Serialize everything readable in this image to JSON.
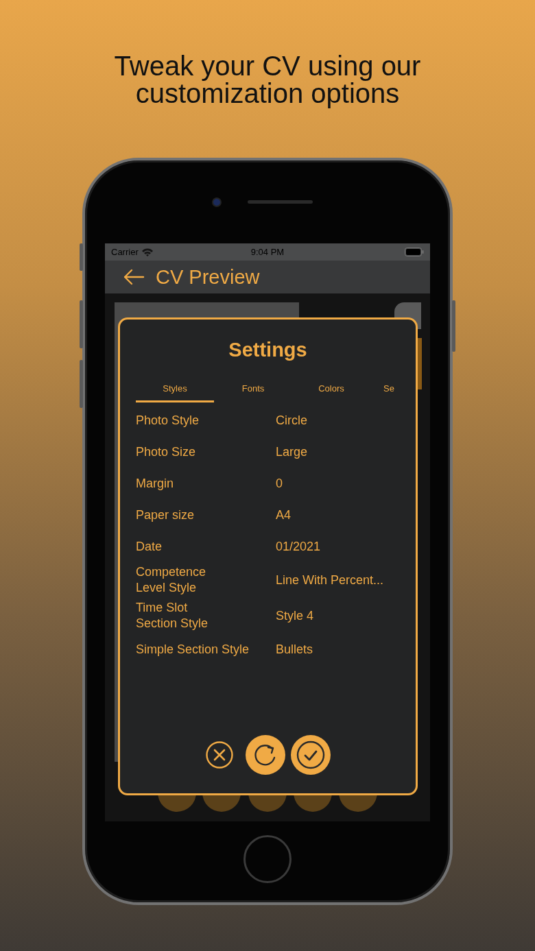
{
  "headline": "Tweak your CV using our customization options",
  "status_bar": {
    "carrier": "Carrier",
    "time": "9:04 PM"
  },
  "nav": {
    "title": "CV Preview"
  },
  "dialog": {
    "title": "Settings",
    "tabs": [
      {
        "label": "Styles",
        "selected": true
      },
      {
        "label": "Fonts",
        "selected": false
      },
      {
        "label": "Colors",
        "selected": false
      },
      {
        "label": "Se",
        "selected": false
      }
    ],
    "rows": [
      {
        "label": "Photo Style",
        "value": "Circle"
      },
      {
        "label": "Photo Size",
        "value": "Large"
      },
      {
        "label": "Margin",
        "value": "0"
      },
      {
        "label": "Paper size",
        "value": "A4"
      },
      {
        "label": "Date",
        "value": "01/2021"
      },
      {
        "label": "Competence\nLevel Style",
        "value": "Line With Percent..."
      },
      {
        "label": "Time Slot\nSection Style",
        "value": "Style 4"
      },
      {
        "label": "Simple Section Style",
        "value": "Bullets"
      }
    ],
    "actions": [
      {
        "kind": "cancel"
      },
      {
        "kind": "reset"
      },
      {
        "kind": "confirm"
      }
    ]
  }
}
